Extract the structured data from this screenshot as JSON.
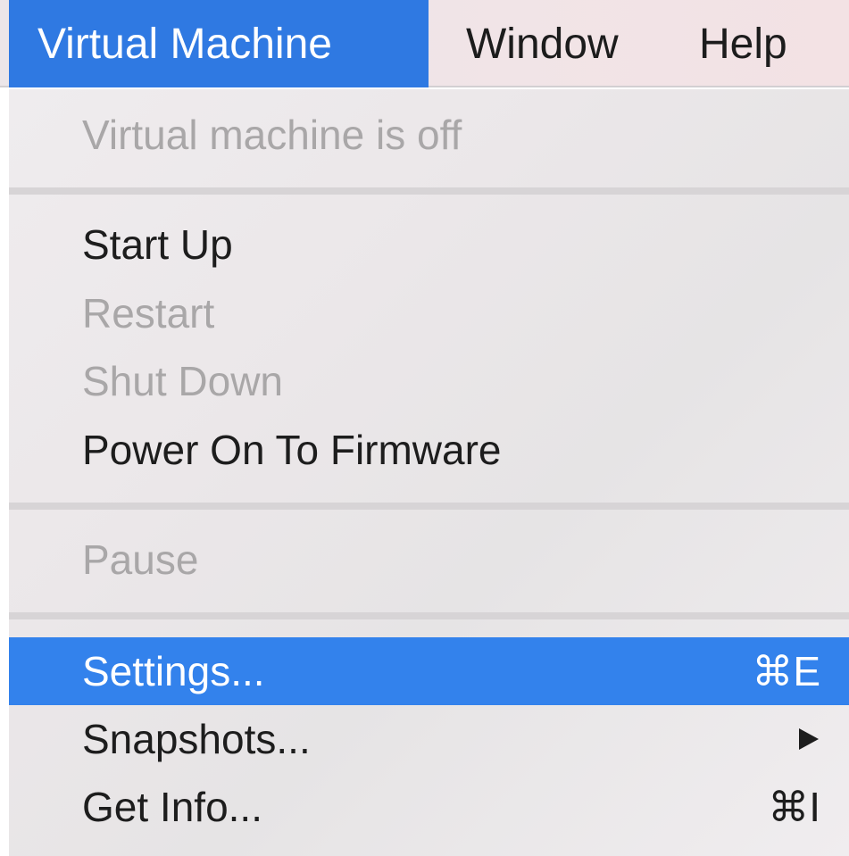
{
  "menubar": {
    "items": [
      {
        "label": "Virtual Machine",
        "active": true
      },
      {
        "label": "Window",
        "active": false
      },
      {
        "label": "Help",
        "active": false
      }
    ]
  },
  "menu": {
    "status": "Virtual machine is off",
    "items": {
      "start_up": {
        "label": "Start Up",
        "enabled": true
      },
      "restart": {
        "label": "Restart",
        "enabled": false
      },
      "shut_down": {
        "label": "Shut Down",
        "enabled": false
      },
      "power_on_firmware": {
        "label": "Power On To Firmware",
        "enabled": true
      },
      "pause": {
        "label": "Pause",
        "enabled": false
      },
      "settings": {
        "label": "Settings...",
        "shortcut": "⌘E",
        "highlighted": true
      },
      "snapshots": {
        "label": "Snapshots...",
        "submenu_icon": "submenu-arrow-icon"
      },
      "get_info": {
        "label": "Get Info...",
        "shortcut": "⌘I"
      }
    }
  },
  "colors": {
    "accent": "#2f79e2",
    "highlight": "#3382ec",
    "disabled_text": "#a9a7a8"
  }
}
